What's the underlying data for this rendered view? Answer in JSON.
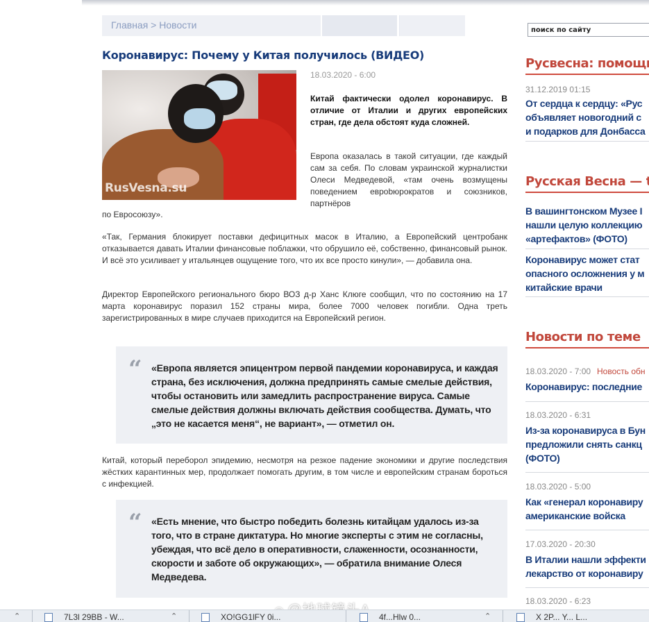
{
  "breadcrumb": {
    "home": "Главная",
    "separator": " > ",
    "section": "Новости"
  },
  "search": {
    "placeholder": "поиск по сайту"
  },
  "article": {
    "title": "Коронавирус: Почему у Китая получилось (ВИДЕО)",
    "date": "18.03.2020 - 6:00",
    "photo_watermark": "RusVesna.su",
    "lead": "Китай фактически одолел коронавирус. В отличие от Италии и других европейских стран, где дела обстоят куда сложней.",
    "p1": "Европа оказалась в такой ситуации, где каждый сам за себя. По словам украинской журналистки Олеси Медведевой, «там очень возмущены поведением еврobюрократов и союзников, партнёров",
    "p1_tail": "по Евросоюзу».",
    "p2": "«Так, Германия блокирует поставки дефицитных масок в Италию, а Европейский центробанк отказывается давать Италии финансовые поблажки, что обрушило её, собственно, финансовый рынок. И всё это усиливает у итальянцев ощущение того, что их все просто кинули», — добавила она.",
    "p3": "Директор Европейского регионального бюро ВОЗ д-р Ханс Клюге сообщил, что по состоянию на 17 марта коронавирус поразил 152 страны мира, более 7000 человек погибли. Одна треть зарегистрированных в мире случаев приходится на Европейский регион.",
    "quote1": "«Европа является эпицентром первой пандемии коронавируса, и каждая страна, без исключения, должна предпринять самые смелые действия, чтобы остановить или замедлить распространение вируса. Самые смелые действия должны включать действия сообщества. Думать, что „это не касается меня“, не вариант», — отметил он.",
    "p4": "Китай, который переборол эпидемию, несмотря на резкое падение экономики и другие последствия жёстких карантинных мер, продолжает помогать другим, в том числе и европейским странам бороться с инфекцией.",
    "quote2": "«Есть мнение, что быстро победить болезнь китайцам удалось из-за того, что в стране диктатура. Но многие эксперты с этим не согласны, убеждая, что всё дело в оперативности, слаженности, осознанности, скорости и заботе об окружающих», — обратила внимание Олеся Медведева.",
    "quote_mark": "“"
  },
  "sidebar": {
    "block1_title": "Русвесна: помощь Д",
    "block1_date": "31.12.2019 01:15",
    "block1_link": [
      "От сердца к сердцу: «Рус",
      "объявляет новогодний с",
      "и подарков для Донбасса"
    ],
    "block2_title": "Русская Весна — the",
    "block2_link1": [
      "В вашингтонском Музее I",
      "нашли целую коллекцию",
      "«артефактов» (ФОТО)"
    ],
    "block2_link2": [
      "Коронавирус может стат",
      "опасного осложнения у м",
      "китайские врачи"
    ],
    "block3_title": "Новости по теме",
    "news": [
      {
        "date": "18.03.2020 - 7:00",
        "tag": "Новость обн",
        "lines": [
          "Коронавирус: последние"
        ]
      },
      {
        "date": "18.03.2020 - 6:31",
        "tag": "",
        "lines": [
          "Из-за коронавируса в Бун",
          "предложили снять санкц",
          "(ФОТО)"
        ]
      },
      {
        "date": "18.03.2020 - 5:00",
        "tag": "",
        "lines": [
          "Как «генерал коронавиру",
          "американские войска"
        ]
      },
      {
        "date": "17.03.2020 - 20:30",
        "tag": "",
        "lines": [
          "В Италии нашли эффекти",
          "лекарство от коронавиру"
        ]
      },
      {
        "date": "18.03.2020 - 6:23",
        "tag": "",
        "lines": []
      }
    ]
  },
  "taskbar": {
    "items": [
      "7L3l 29BB - W...",
      "XO!GG1lFY 0i...",
      "4f...Hlw 0...",
      "X 2P... Y... L..."
    ]
  },
  "overlay": {
    "weibo": "@地球镜头A"
  }
}
